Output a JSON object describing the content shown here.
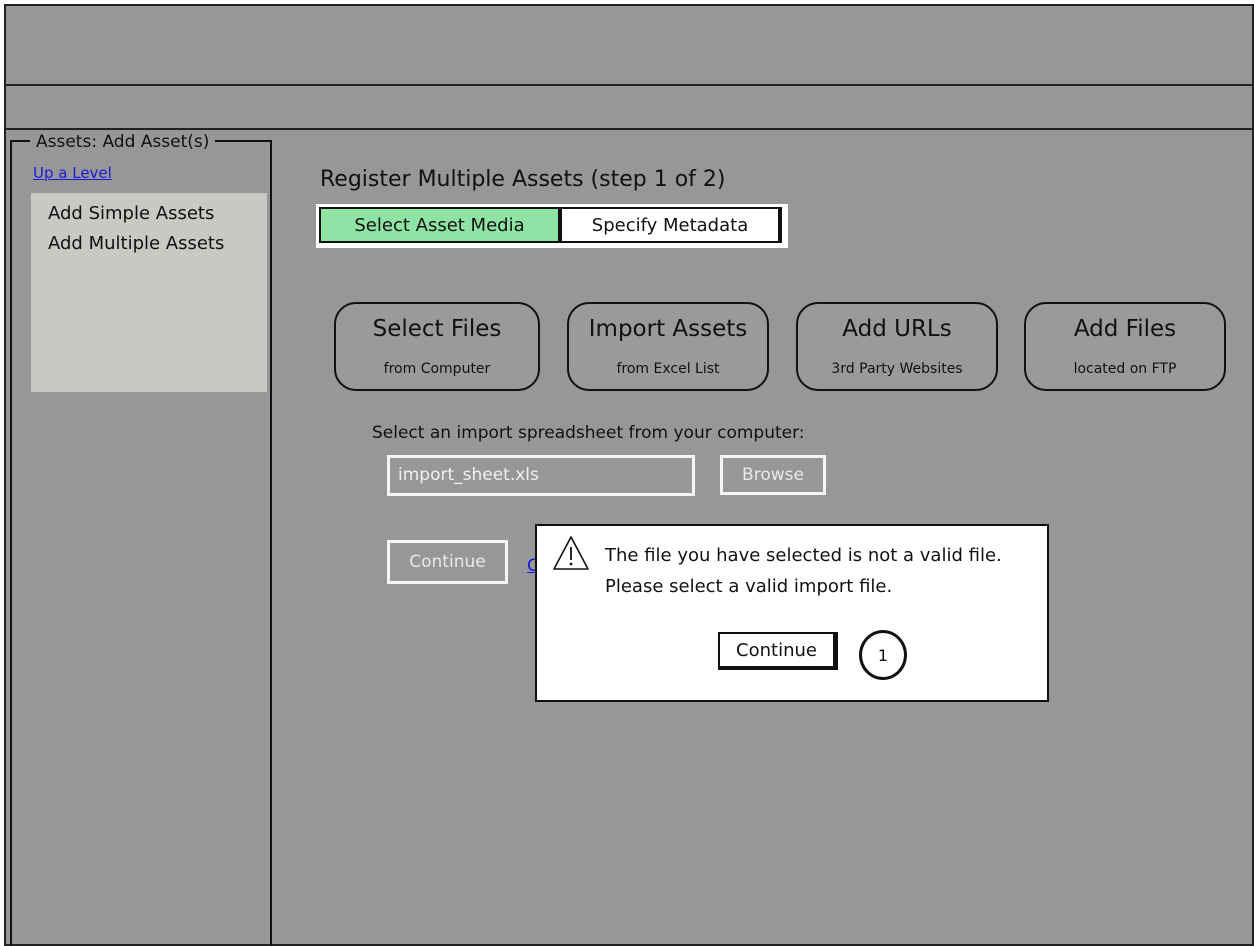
{
  "sidebar": {
    "legend": "Assets: Add Asset(s)",
    "up_link": "Up a Level",
    "items": [
      {
        "label": "Add Simple Assets"
      },
      {
        "label": "Add Multiple Assets"
      }
    ]
  },
  "main": {
    "title": "Register Multiple Assets (step 1 of 2)",
    "tabs": [
      {
        "label": "Select Asset Media",
        "active": true
      },
      {
        "label": "Specify Metadata",
        "active": false
      }
    ],
    "options": [
      {
        "title": "Select Files",
        "subtitle": "from Computer"
      },
      {
        "title": "Import Assets",
        "subtitle": "from Excel List"
      },
      {
        "title": "Add URLs",
        "subtitle": "3rd Party Websites"
      },
      {
        "title": "Add Files",
        "subtitle": "located on FTP"
      }
    ],
    "instruction": "Select an import spreadsheet from your computer:",
    "file_input_value": "import_sheet.xls",
    "browse_label": "Browse",
    "continue_label": "Continue",
    "cancel_link_partial": "C"
  },
  "dialog": {
    "message": "The file you have selected is not a valid file.  Please select a valid import file.",
    "continue_label": "Continue",
    "callout_number": "1"
  },
  "colors": {
    "background": "#979797",
    "active_tab": "#8fe3a4",
    "nav_box": "#c6c9c4",
    "link": "#1a1adc"
  }
}
